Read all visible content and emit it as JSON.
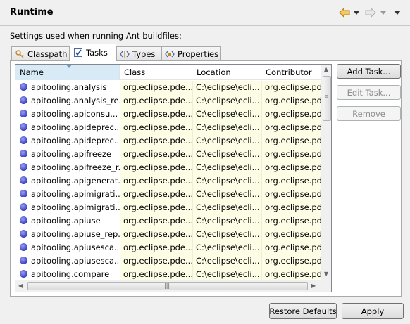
{
  "header": {
    "title": "Runtime"
  },
  "description": "Settings used when running Ant buildfiles:",
  "tabs": [
    {
      "label": "Classpath",
      "icon": "classpath-icon"
    },
    {
      "label": "Tasks",
      "icon": "tasks-icon"
    },
    {
      "label": "Types",
      "icon": "types-icon"
    },
    {
      "label": "Properties",
      "icon": "properties-icon"
    }
  ],
  "selected_tab": "Tasks",
  "table": {
    "columns": [
      "Name",
      "Class",
      "Location",
      "Contributor"
    ],
    "rows": [
      [
        "apitooling.analysis",
        "org.eclipse.pde...",
        "C:\\eclipse\\ecli...",
        "org.eclipse.pd..."
      ],
      [
        "apitooling.analysis_re...",
        "org.eclipse.pde...",
        "C:\\eclipse\\ecli...",
        "org.eclipse.pd..."
      ],
      [
        "apitooling.apiconsu...",
        "org.eclipse.pde...",
        "C:\\eclipse\\ecli...",
        "org.eclipse.pd..."
      ],
      [
        "apitooling.apideprec...",
        "org.eclipse.pde...",
        "C:\\eclipse\\ecli...",
        "org.eclipse.pd..."
      ],
      [
        "apitooling.apideprec...",
        "org.eclipse.pde...",
        "C:\\eclipse\\ecli...",
        "org.eclipse.pd..."
      ],
      [
        "apitooling.apifreeze",
        "org.eclipse.pde...",
        "C:\\eclipse\\ecli...",
        "org.eclipse.pd..."
      ],
      [
        "apitooling.apifreeze_r...",
        "org.eclipse.pde...",
        "C:\\eclipse\\ecli...",
        "org.eclipse.pd..."
      ],
      [
        "apitooling.apigenerat...",
        "org.eclipse.pde...",
        "C:\\eclipse\\ecli...",
        "org.eclipse.pd..."
      ],
      [
        "apitooling.apimigrati...",
        "org.eclipse.pde...",
        "C:\\eclipse\\ecli...",
        "org.eclipse.pd..."
      ],
      [
        "apitooling.apimigrati...",
        "org.eclipse.pde...",
        "C:\\eclipse\\ecli...",
        "org.eclipse.pd..."
      ],
      [
        "apitooling.apiuse",
        "org.eclipse.pde...",
        "C:\\eclipse\\ecli...",
        "org.eclipse.pd..."
      ],
      [
        "apitooling.apiuse_rep...",
        "org.eclipse.pde...",
        "C:\\eclipse\\ecli...",
        "org.eclipse.pd..."
      ],
      [
        "apitooling.apiusesca...",
        "org.eclipse.pde...",
        "C:\\eclipse\\ecli...",
        "org.eclipse.pd..."
      ],
      [
        "apitooling.apiusesca...",
        "org.eclipse.pde...",
        "C:\\eclipse\\ecli...",
        "org.eclipse.pd..."
      ],
      [
        "apitooling.compare",
        "org.eclipse.pde...",
        "C:\\eclipse\\ecli...",
        "org.eclipse.pd..."
      ]
    ]
  },
  "buttons": {
    "add_task": "Add Task...",
    "edit_task": "Edit Task...",
    "remove": "Remove",
    "restore_defaults": "Restore Defaults",
    "apply": "Apply"
  },
  "colors": {
    "arrow": "#e8a33a",
    "task_icon": "#3a3fb8",
    "cell_bg": "#fdfde6"
  }
}
